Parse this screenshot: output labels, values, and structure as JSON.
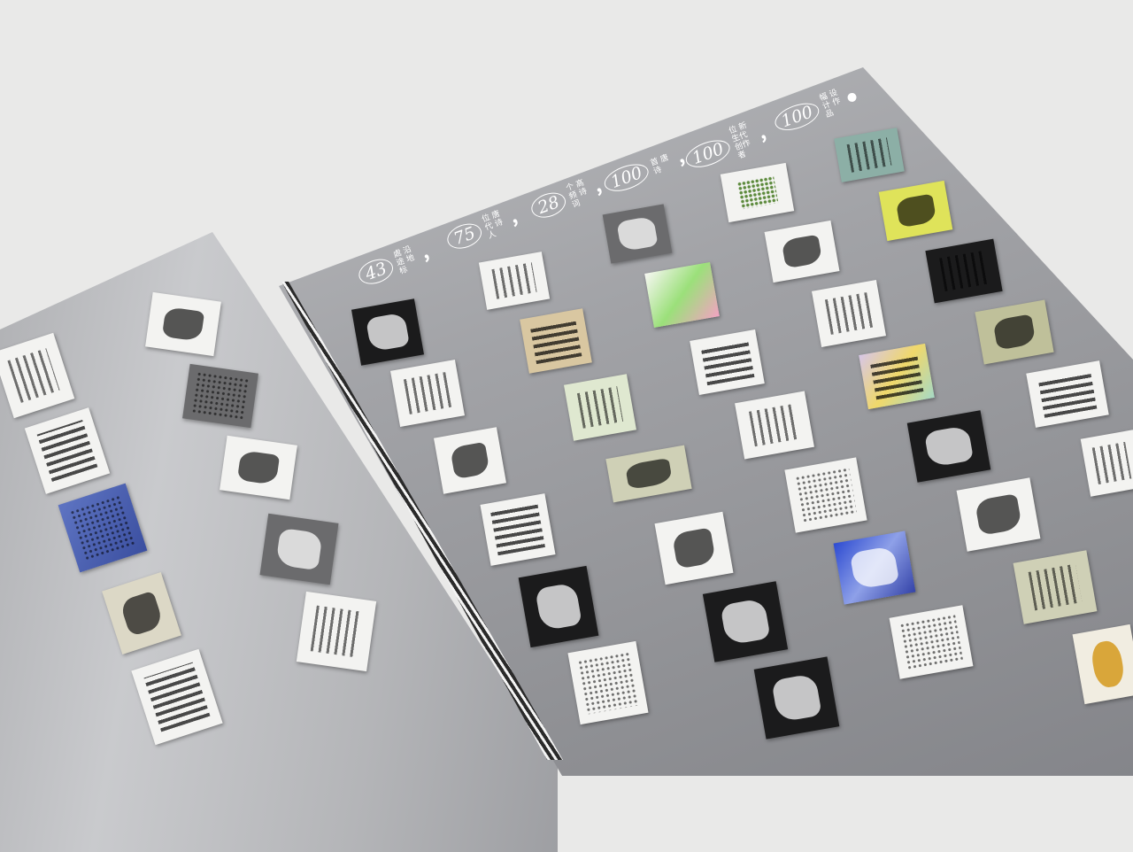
{
  "headline": {
    "stats": [
      {
        "number": "43",
        "unit": "處 沿途 地标"
      },
      {
        "number": "75",
        "unit": "位 唐代 诗人"
      },
      {
        "number": "28",
        "unit": "个 高频 诗词"
      },
      {
        "number": "100",
        "unit": "首 唐诗"
      },
      {
        "number": "100",
        "unit": "位 新生代 创作者"
      },
      {
        "number": "100",
        "unit": "幅 设计 作品"
      }
    ],
    "separator": "，",
    "end_mark": "●"
  },
  "colors": {
    "background": "#e9e9e8",
    "silver_page": "#a2a3a7",
    "headline_text": "#ffffff"
  },
  "thumbnail_styles": [
    "t-white g-blot",
    "t-white g-lines",
    "t-gray g-dots",
    "t-white g-hlines",
    "t-blue g-dots",
    "t-white g-blot",
    "t-gray g-lightblot",
    "t-beige g-blot",
    "t-white g-lines",
    "t-white g-hlines",
    "t-dark g-lightblot",
    "t-white g-lines",
    "t-white g-lines",
    "t-tan g-hlines",
    "t-green g-lines",
    "t-white g-blot",
    "t-white g-hlines",
    "t-dark g-lightblot",
    "t-white g-dots",
    "t-sage g-blot",
    "t-gray g-lightblot",
    "t-rosegreen",
    "t-white g-blot",
    "t-white g-hlines",
    "t-dark g-lightblot",
    "t-white g-lines",
    "t-white g-dots",
    "t-dark g-lightblot",
    "t-white g-greenink",
    "t-white g-blot",
    "t-white g-lines",
    "t-multi g-hlines",
    "t-blueink g-lightblot",
    "t-teal g-lines",
    "t-lime g-blot",
    "t-dark g-lines",
    "t-olive g-blot",
    "t-white g-hlines",
    "t-dark g-lightblot",
    "t-white g-blot",
    "t-white g-dots",
    "t-sage g-lines",
    "t-white g-lines",
    "t-gold g-gold"
  ]
}
